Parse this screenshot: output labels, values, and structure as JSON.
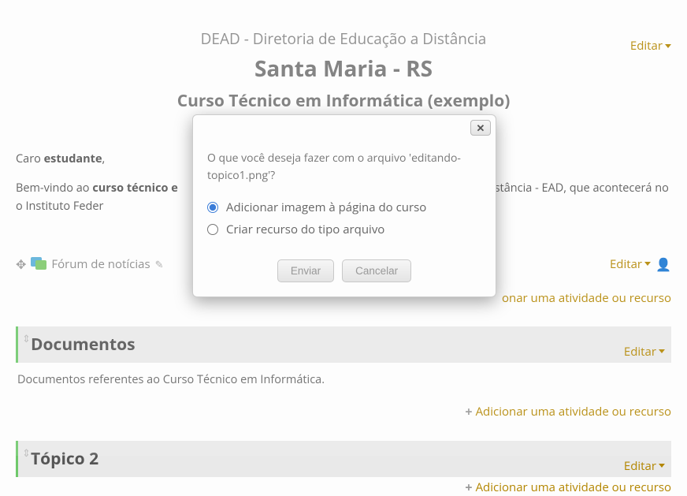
{
  "header": {
    "title1": "DEAD - Diretoria de Educação a Distância",
    "title2": "Santa Maria - RS",
    "title3": "Curso Técnico em Informática (exemplo)",
    "edit_label": "Editar"
  },
  "intro": {
    "greeting_prefix": "Caro ",
    "greeting_bold": "estudante",
    "greeting_suffix": ",",
    "line2_prefix": "Bem-vindo ao ",
    "line2_bold": "curso técnico e",
    "line2_suffix": "Distância - EAD, que acontecerá no o Instituto Feder"
  },
  "forum": {
    "label": "Fórum de notícias",
    "edit_label": "Editar"
  },
  "add_activity_label": "Adicionar uma atividade ou recurso",
  "sections": [
    {
      "title": "Documentos",
      "edit_label": "Editar",
      "desc": "Documentos referentes ao Curso Técnico em Informática."
    },
    {
      "title": "Tópico 2",
      "edit_label": "Editar",
      "desc": ""
    }
  ],
  "modal": {
    "question": "O que você deseja fazer com o arquivo 'editando-topico1.png'?",
    "option1": "Adicionar imagem à página do curso",
    "option2": "Criar recurso do tipo arquivo",
    "submit": "Enviar",
    "cancel": "Cancelar",
    "close": "✕"
  }
}
